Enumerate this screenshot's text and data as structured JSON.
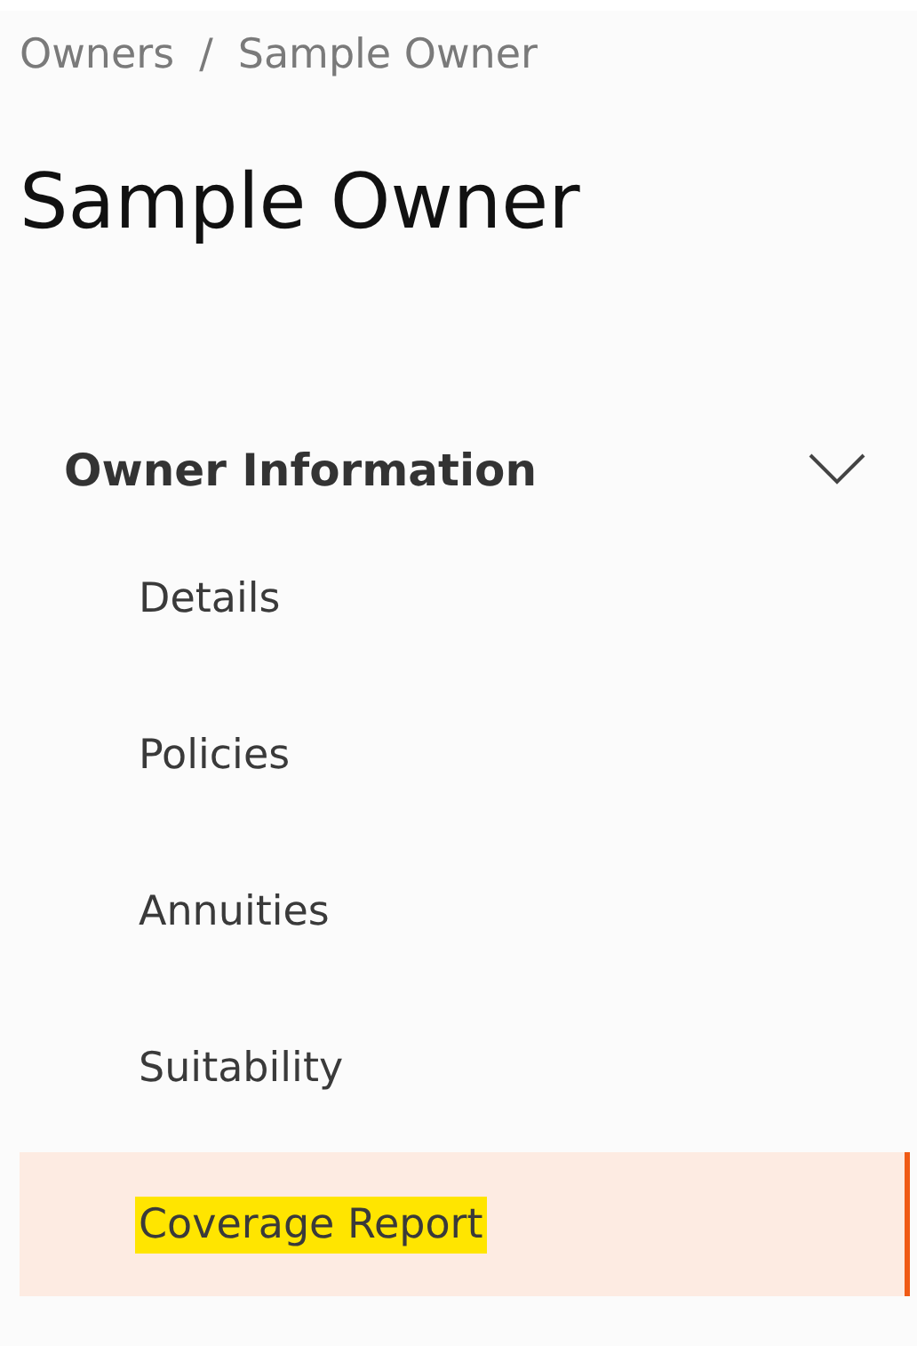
{
  "breadcrumb": [
    {
      "label": "Owners"
    },
    {
      "label": "Sample Owner"
    }
  ],
  "breadcrumb_separator": "/",
  "title": "Sample Owner",
  "section": {
    "label": "Owner Information",
    "expanded": true,
    "items": [
      {
        "label": "Details",
        "selected": false,
        "highlighted": false
      },
      {
        "label": "Policies",
        "selected": false,
        "highlighted": false
      },
      {
        "label": "Annuities",
        "selected": false,
        "highlighted": false
      },
      {
        "label": "Suitability",
        "selected": false,
        "highlighted": false
      },
      {
        "label": "Coverage Report",
        "selected": true,
        "highlighted": true
      }
    ]
  }
}
